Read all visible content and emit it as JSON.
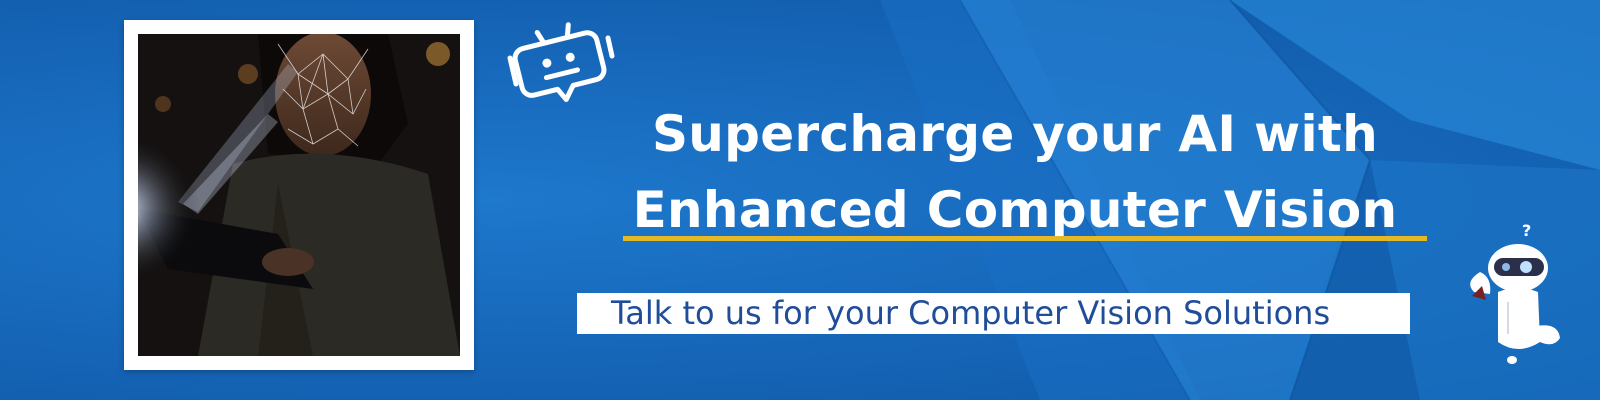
{
  "banner": {
    "headline": {
      "line1": "Supercharge your AI with",
      "line2": "Enhanced Computer Vision"
    },
    "cta_label": "Talk to us for your Computer Vision Solutions",
    "colors": {
      "background": "#1666b8",
      "accent_underline": "#e5b925",
      "cta_text": "#1f4d9a",
      "headline_text": "#ffffff"
    },
    "icons": [
      "chat-bot-icon",
      "robot-mascot-icon"
    ],
    "photo": "woman-with-face-scan-mesh-using-tablet"
  }
}
